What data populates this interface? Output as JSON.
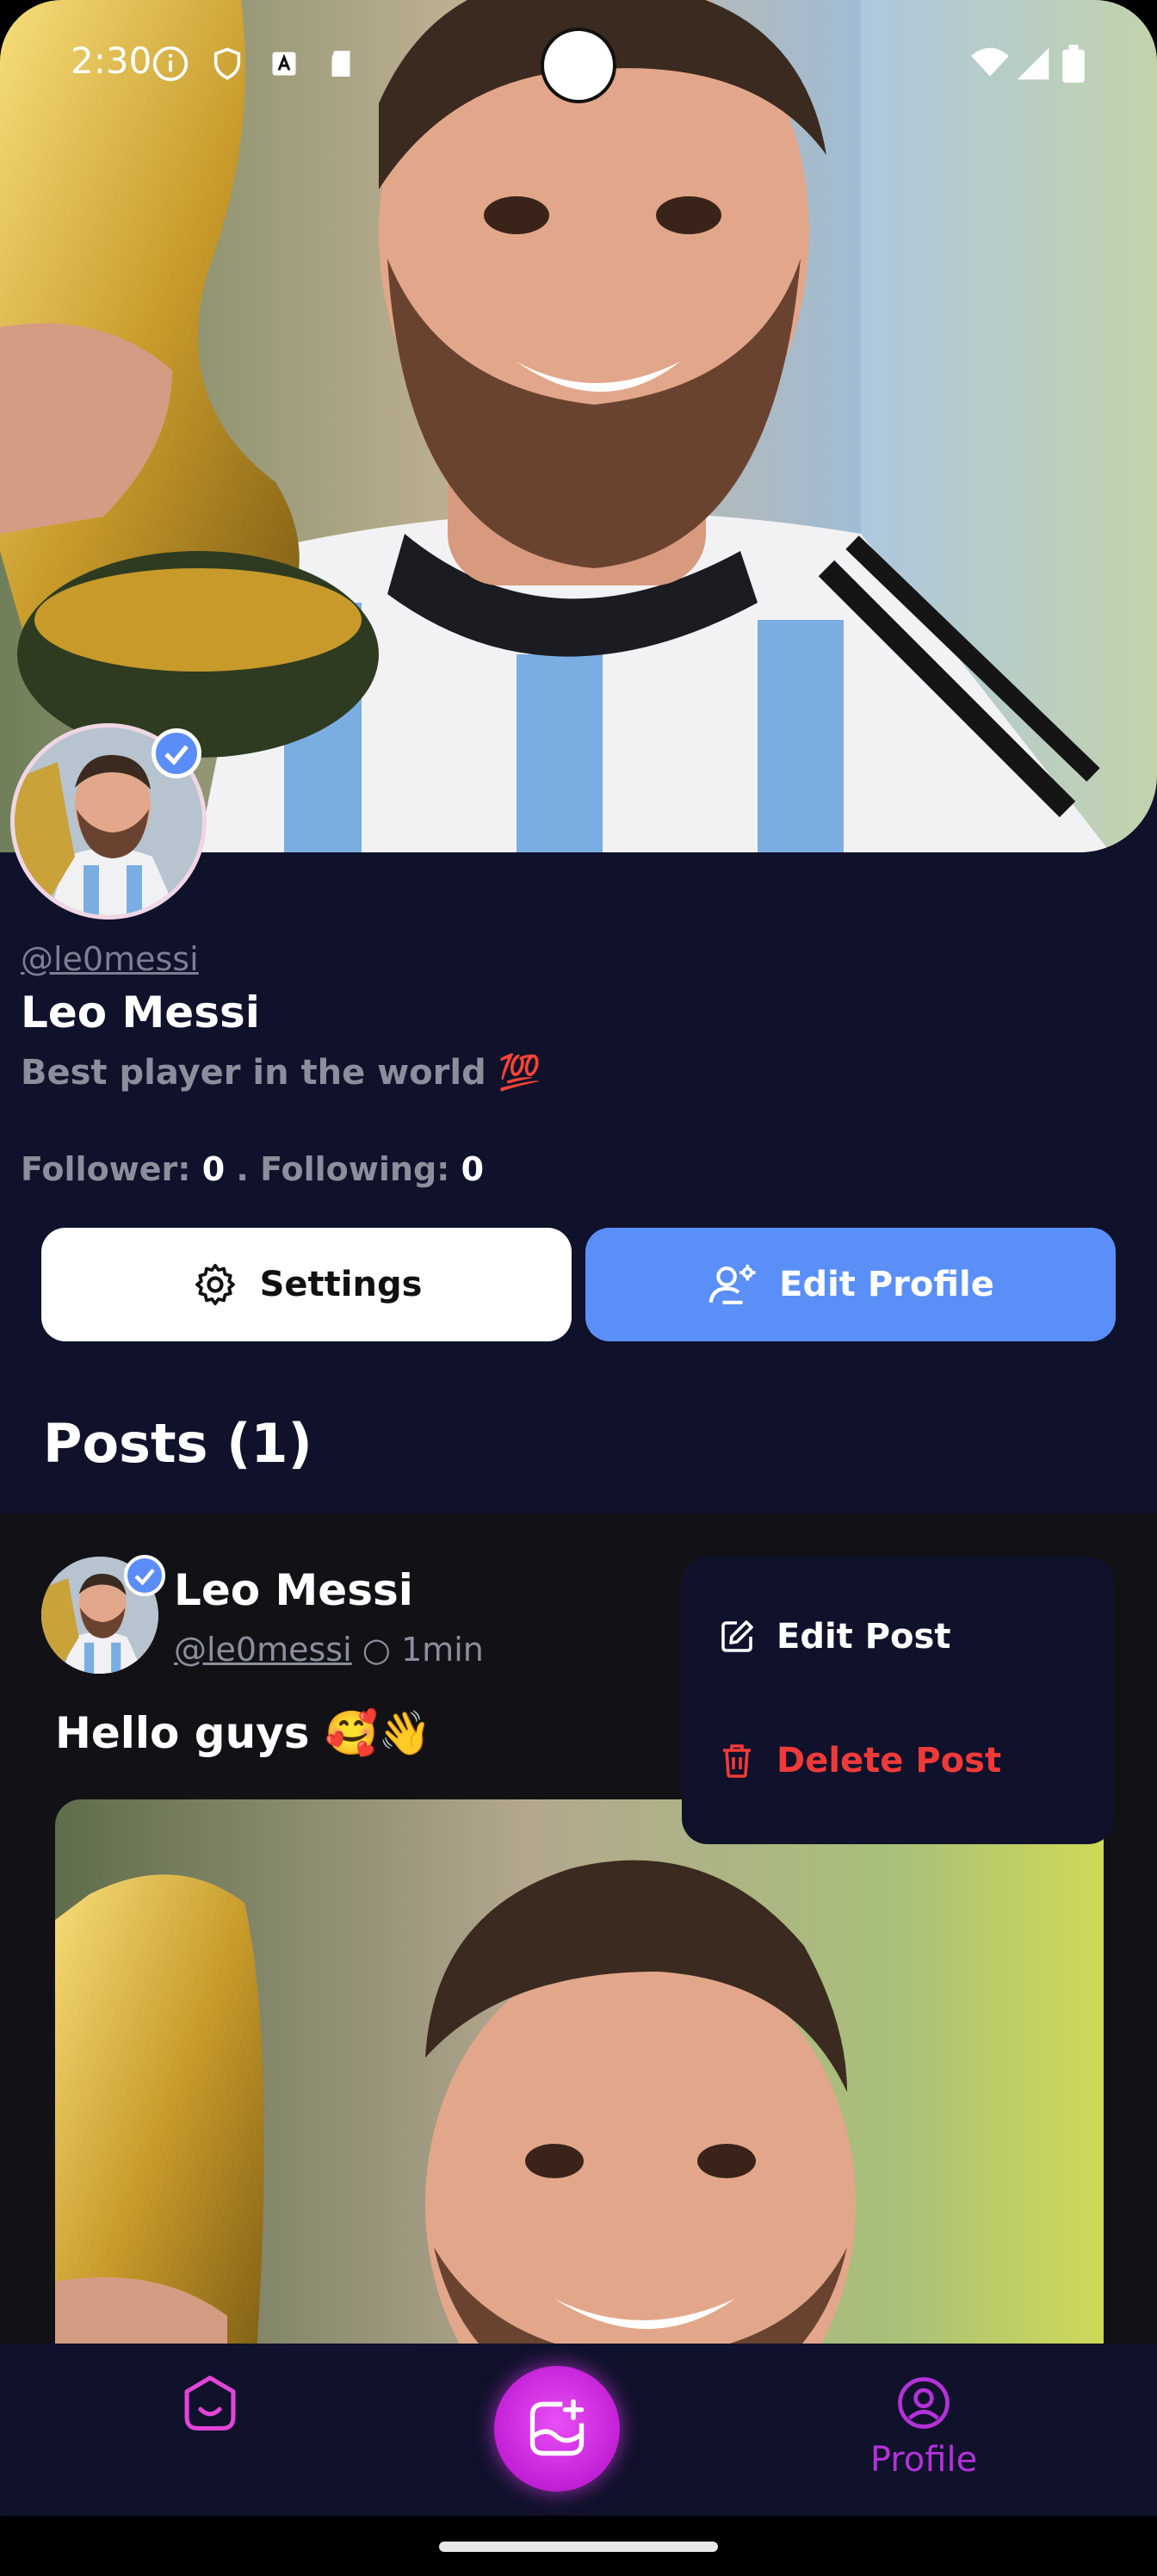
{
  "status_bar": {
    "time": "2:30"
  },
  "profile": {
    "handle": "@le0messi",
    "name": "Leo Messi",
    "bio": "Best player in the world 💯",
    "follower_label": "Follower:",
    "follower_count": "0",
    "separator": " . ",
    "following_label": "Following:",
    "following_count": "0"
  },
  "actions": {
    "settings_label": "Settings",
    "edit_profile_label": "Edit Profile"
  },
  "posts_section": {
    "title": "Posts (1)"
  },
  "post": {
    "author_name": "Leo Messi",
    "author_handle": "@le0messi",
    "meta_separator": " ○ ",
    "time_ago": "1min",
    "text": "Hello guys 🥰👋"
  },
  "post_menu": {
    "edit_label": "Edit Post",
    "delete_label": "Delete Post"
  },
  "bottom_nav": {
    "profile_label": "Profile"
  },
  "colors": {
    "background": "#10112b",
    "accent_blue": "#5b8ff8",
    "accent_magenta": "#c21fd6",
    "danger": "#ef3a3a",
    "post_background": "#121216"
  },
  "icons": [
    "wifi-icon",
    "signal-icon",
    "battery-icon",
    "gear-icon",
    "user-settings-icon",
    "verified-badge-icon",
    "pencil-square-icon",
    "trash-icon",
    "home-icon",
    "add-photo-icon",
    "profile-icon"
  ]
}
